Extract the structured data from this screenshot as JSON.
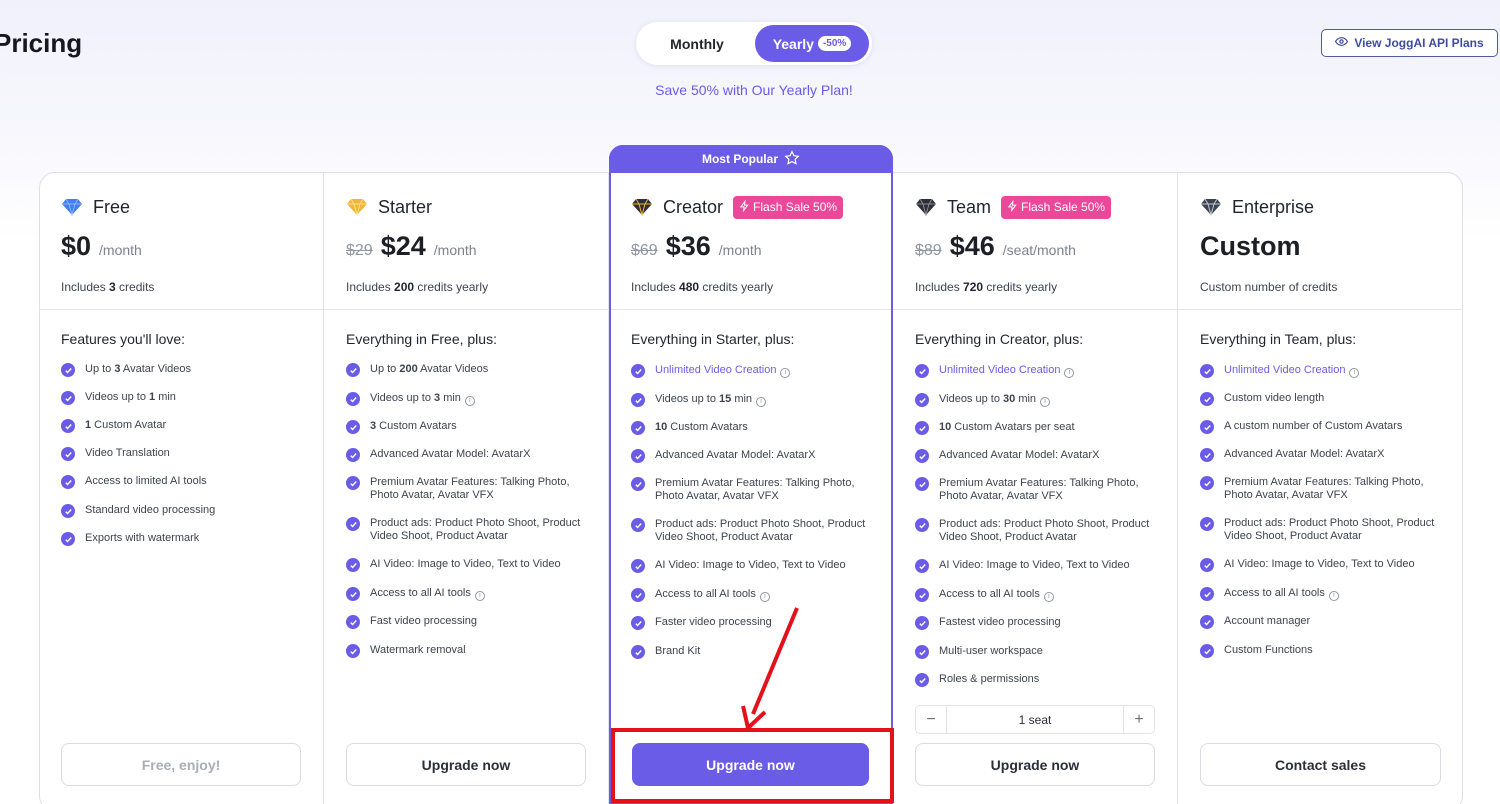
{
  "page": {
    "title": "Pricing"
  },
  "billing": {
    "monthly_label": "Monthly",
    "yearly_label": "Yearly",
    "yearly_badge": "-50%",
    "save_text": "Save 50% with Our Yearly Plan!"
  },
  "api_button": {
    "label": "View JoggAI API Plans",
    "icon": "eye-icon"
  },
  "popular": {
    "label": "Most Popular",
    "icon": "star-icon"
  },
  "colors": {
    "accent": "#6b5ce7",
    "flash": "#ec4899",
    "annotation": "#e3121a"
  },
  "plans": [
    {
      "name": "Free",
      "icon": "diamond-blue-icon",
      "badge": "",
      "old_price": "",
      "price": "$0",
      "per": "/month",
      "credits_prefix": "Includes ",
      "credits_bold": "3",
      "credits_suffix": " credits",
      "features_title": "Features you'll love:",
      "features": [
        {
          "pre": "Up to ",
          "b": "3",
          "post": " Avatar Videos",
          "hl": false,
          "info": false
        },
        {
          "pre": "Videos up to ",
          "b": "1",
          "post": " min",
          "hl": false,
          "info": false
        },
        {
          "pre": "",
          "b": "1",
          "post": " Custom Avatar",
          "hl": false,
          "info": false
        },
        {
          "pre": "Video Translation",
          "b": "",
          "post": "",
          "hl": false,
          "info": false
        },
        {
          "pre": "Access to limited AI tools",
          "b": "",
          "post": "",
          "hl": false,
          "info": false
        },
        {
          "pre": "Standard video processing",
          "b": "",
          "post": "",
          "hl": false,
          "info": false
        },
        {
          "pre": "Exports with watermark",
          "b": "",
          "post": "",
          "hl": false,
          "info": false
        }
      ],
      "cta": "Free, enjoy!"
    },
    {
      "name": "Starter",
      "icon": "diamond-gold-icon",
      "badge": "",
      "old_price": "$29",
      "price": "$24",
      "per": "/month",
      "credits_prefix": "Includes ",
      "credits_bold": "200",
      "credits_suffix": " credits yearly",
      "features_title": "Everything in Free, plus:",
      "features": [
        {
          "pre": "Up to ",
          "b": "200",
          "post": " Avatar Videos",
          "hl": false,
          "info": false
        },
        {
          "pre": "Videos up to ",
          "b": "3",
          "post": " min",
          "hl": false,
          "info": true
        },
        {
          "pre": "",
          "b": "3",
          "post": " Custom Avatars",
          "hl": false,
          "info": false
        },
        {
          "pre": "Advanced Avatar Model: AvatarX",
          "b": "",
          "post": "",
          "hl": false,
          "info": false
        },
        {
          "pre": "Premium Avatar Features: Talking Photo, Photo Avatar, Avatar VFX",
          "b": "",
          "post": "",
          "hl": false,
          "info": false
        },
        {
          "pre": "Product ads: Product Photo Shoot, Product Video Shoot, Product Avatar",
          "b": "",
          "post": "",
          "hl": false,
          "info": false
        },
        {
          "pre": "AI Video: Image to Video, Text to Video",
          "b": "",
          "post": "",
          "hl": false,
          "info": false
        },
        {
          "pre": "Access to all AI tools",
          "b": "",
          "post": "",
          "hl": false,
          "info": true
        },
        {
          "pre": "Fast video processing",
          "b": "",
          "post": "",
          "hl": false,
          "info": false
        },
        {
          "pre": "Watermark removal",
          "b": "",
          "post": "",
          "hl": false,
          "info": false
        }
      ],
      "cta": "Upgrade now"
    },
    {
      "name": "Creator",
      "icon": "diamond-crown-icon",
      "badge": "Flash Sale 50%",
      "old_price": "$69",
      "price": "$36",
      "per": "/month",
      "credits_prefix": "Includes ",
      "credits_bold": "480",
      "credits_suffix": " credits yearly",
      "features_title": "Everything in Starter, plus:",
      "features": [
        {
          "pre": "Unlimited Video Creation",
          "b": "",
          "post": "",
          "hl": true,
          "info": true
        },
        {
          "pre": "Videos up to ",
          "b": "15",
          "post": " min",
          "hl": false,
          "info": true
        },
        {
          "pre": "",
          "b": "10",
          "post": " Custom Avatars",
          "hl": false,
          "info": false
        },
        {
          "pre": "Advanced Avatar Model: AvatarX",
          "b": "",
          "post": "",
          "hl": false,
          "info": false
        },
        {
          "pre": "Premium Avatar Features: Talking Photo, Photo Avatar, Avatar VFX",
          "b": "",
          "post": "",
          "hl": false,
          "info": false
        },
        {
          "pre": "Product ads: Product Photo Shoot, Product Video Shoot, Product Avatar",
          "b": "",
          "post": "",
          "hl": false,
          "info": false
        },
        {
          "pre": "AI Video: Image to Video, Text to Video",
          "b": "",
          "post": "",
          "hl": false,
          "info": false
        },
        {
          "pre": "Access to all AI tools",
          "b": "",
          "post": "",
          "hl": false,
          "info": true
        },
        {
          "pre": "Faster video processing",
          "b": "",
          "post": "",
          "hl": false,
          "info": false
        },
        {
          "pre": "Brand Kit",
          "b": "",
          "post": "",
          "hl": false,
          "info": false
        }
      ],
      "cta": "Upgrade now"
    },
    {
      "name": "Team",
      "icon": "diamond-dark-icon",
      "badge": "Flash Sale 50%",
      "old_price": "$89",
      "price": "$46",
      "per": "/seat/month",
      "credits_prefix": "Includes ",
      "credits_bold": "720",
      "credits_suffix": " credits yearly",
      "features_title": "Everything in Creator, plus:",
      "features": [
        {
          "pre": "Unlimited Video Creation",
          "b": "",
          "post": "",
          "hl": true,
          "info": true
        },
        {
          "pre": "Videos up to ",
          "b": "30",
          "post": " min",
          "hl": false,
          "info": true
        },
        {
          "pre": "",
          "b": "10",
          "post": " Custom Avatars per seat",
          "hl": false,
          "info": false
        },
        {
          "pre": "Advanced Avatar Model: AvatarX",
          "b": "",
          "post": "",
          "hl": false,
          "info": false
        },
        {
          "pre": "Premium Avatar Features: Talking Photo, Photo Avatar, Avatar VFX",
          "b": "",
          "post": "",
          "hl": false,
          "info": false
        },
        {
          "pre": "Product ads: Product Photo Shoot, Product Video Shoot, Product Avatar",
          "b": "",
          "post": "",
          "hl": false,
          "info": false
        },
        {
          "pre": "AI Video: Image to Video, Text to Video",
          "b": "",
          "post": "",
          "hl": false,
          "info": false
        },
        {
          "pre": "Access to all AI tools",
          "b": "",
          "post": "",
          "hl": false,
          "info": true
        },
        {
          "pre": "Fastest video processing",
          "b": "",
          "post": "",
          "hl": false,
          "info": false
        },
        {
          "pre": "Multi-user workspace",
          "b": "",
          "post": "",
          "hl": false,
          "info": false
        },
        {
          "pre": "Roles & permissions",
          "b": "",
          "post": "",
          "hl": false,
          "info": false
        }
      ],
      "seats": {
        "minus": "−",
        "value": "1 seat",
        "plus": "+"
      },
      "cta": "Upgrade now"
    },
    {
      "name": "Enterprise",
      "icon": "diamond-slate-icon",
      "badge": "",
      "old_price": "",
      "price": "Custom",
      "per": "",
      "credits_prefix": "Custom number of credits",
      "credits_bold": "",
      "credits_suffix": "",
      "features_title": "Everything in Team, plus:",
      "features": [
        {
          "pre": "Unlimited Video Creation",
          "b": "",
          "post": "",
          "hl": true,
          "info": true
        },
        {
          "pre": "Custom video length",
          "b": "",
          "post": "",
          "hl": false,
          "info": false
        },
        {
          "pre": "A custom number of Custom Avatars",
          "b": "",
          "post": "",
          "hl": false,
          "info": false
        },
        {
          "pre": "Advanced Avatar Model: AvatarX",
          "b": "",
          "post": "",
          "hl": false,
          "info": false
        },
        {
          "pre": "Premium Avatar Features: Talking Photo, Photo Avatar, Avatar VFX",
          "b": "",
          "post": "",
          "hl": false,
          "info": false
        },
        {
          "pre": "Product ads: Product Photo Shoot, Product Video Shoot, Product Avatar",
          "b": "",
          "post": "",
          "hl": false,
          "info": false
        },
        {
          "pre": "AI Video: Image to Video, Text to Video",
          "b": "",
          "post": "",
          "hl": false,
          "info": false
        },
        {
          "pre": "Access to all AI tools",
          "b": "",
          "post": "",
          "hl": false,
          "info": true
        },
        {
          "pre": "Account manager",
          "b": "",
          "post": "",
          "hl": false,
          "info": false
        },
        {
          "pre": "Custom Functions",
          "b": "",
          "post": "",
          "hl": false,
          "info": false
        }
      ],
      "cta": "Contact sales"
    }
  ]
}
